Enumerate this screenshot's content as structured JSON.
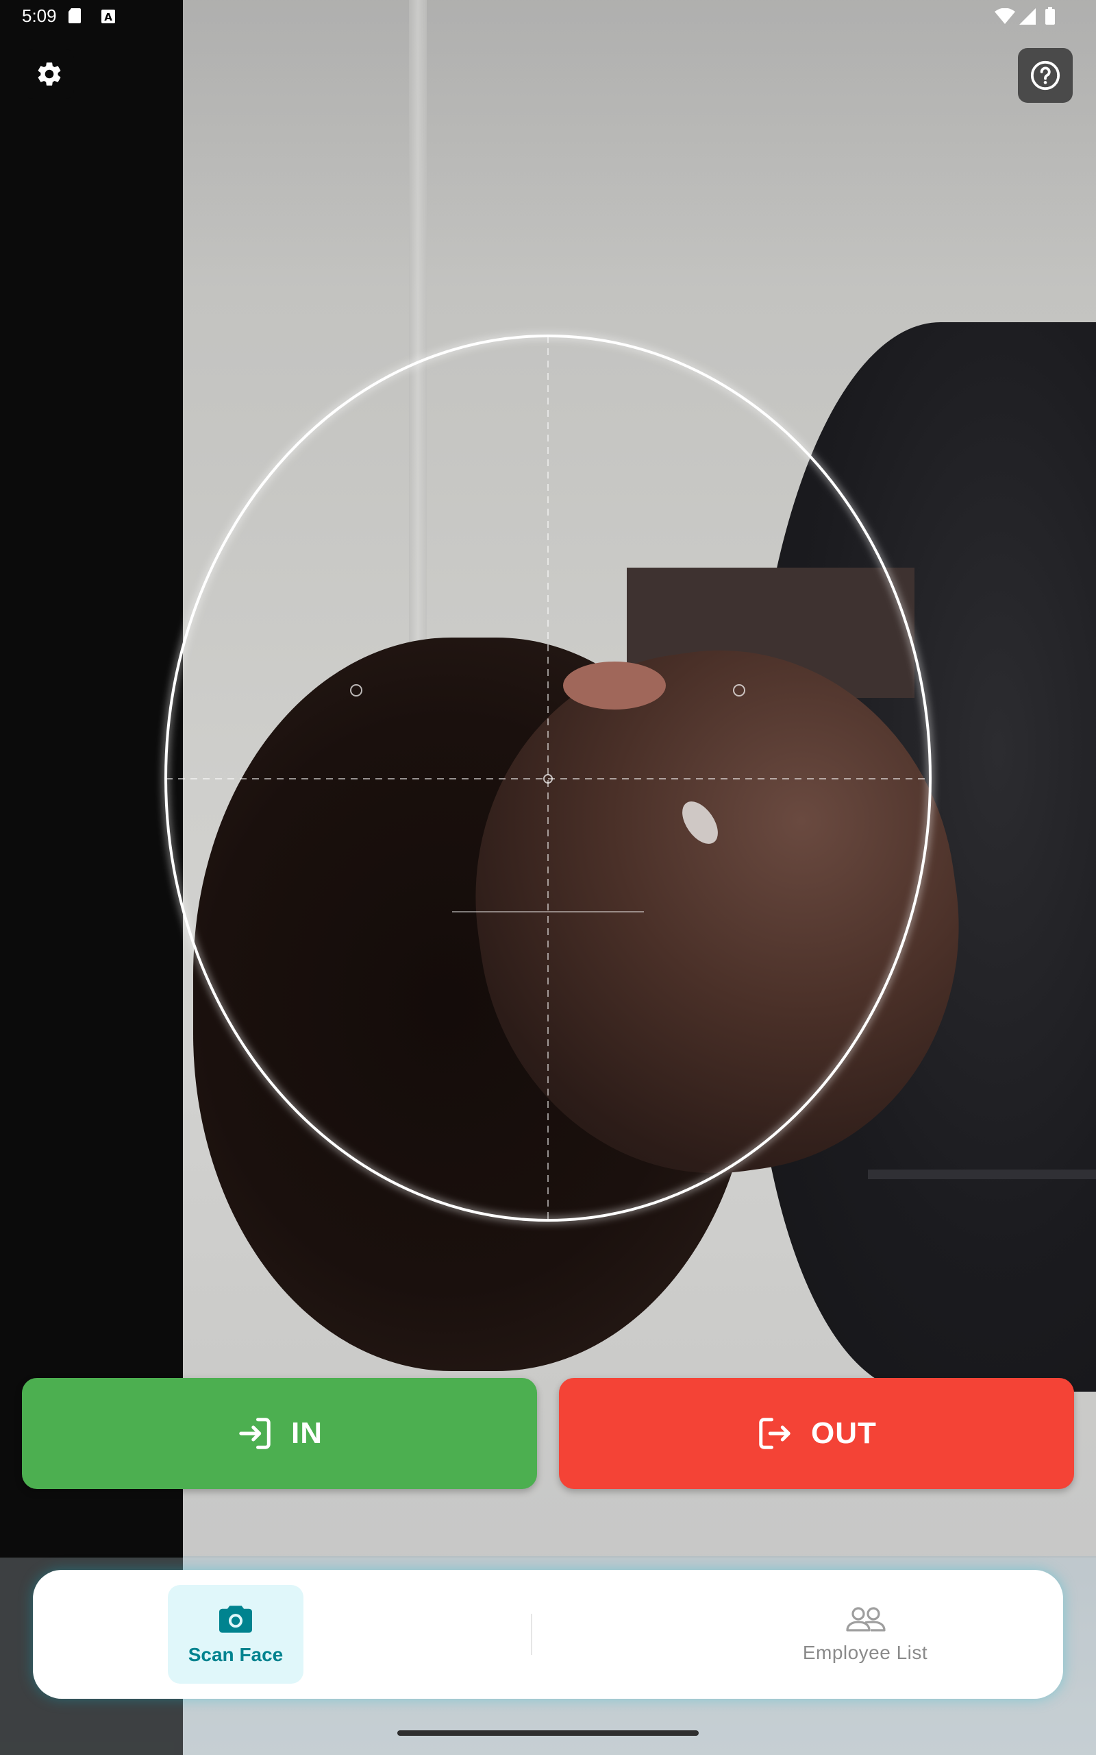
{
  "status_bar": {
    "time": "5:09",
    "icons": [
      "sd-card-icon",
      "a-notification-icon",
      "wifi-icon",
      "signal-icon",
      "battery-icon"
    ]
  },
  "top_controls": {
    "settings_icon": "gear-icon",
    "help_icon": "help-circle-icon"
  },
  "actions": {
    "in_label": "IN",
    "in_icon": "login-icon",
    "in_color": "#4caf50",
    "out_label": "OUT",
    "out_icon": "logout-icon",
    "out_color": "#f44336"
  },
  "bottom_nav": {
    "items": [
      {
        "label": "Scan Face",
        "icon": "camera-icon",
        "active": true
      },
      {
        "label": "Employee List",
        "icon": "people-icon",
        "active": false
      }
    ],
    "accent_color": "#00838f",
    "active_bg": "#e0f7fa"
  }
}
